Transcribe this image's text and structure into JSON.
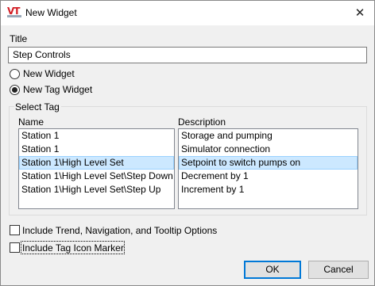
{
  "window": {
    "title": "New Widget",
    "close_glyph": "✕",
    "app_icon": "vtscada-logo-icon",
    "app_icon_text": "VT"
  },
  "title_field": {
    "label": "Title",
    "value": "Step Controls"
  },
  "widget_type": {
    "options": [
      {
        "label": "New Widget",
        "checked": false
      },
      {
        "label": "New Tag Widget",
        "checked": true
      }
    ]
  },
  "select_tag": {
    "group_label": "Select Tag",
    "name_header": "Name",
    "description_header": "Description",
    "names": [
      "Station 1",
      "Station 1",
      "Station 1\\High Level Set",
      "Station 1\\High Level Set\\Step Down",
      "Station 1\\High Level Set\\Step Up"
    ],
    "descriptions": [
      "Storage and pumping",
      "Simulator connection",
      "Setpoint to switch pumps on",
      "Decrement by 1",
      "Increment by 1"
    ],
    "selected_index": 2
  },
  "options": {
    "include_trend": {
      "label": "Include Trend, Navigation, and Tooltip Options",
      "checked": false
    },
    "include_icon": {
      "label": "Include Tag Icon Marker",
      "checked": false
    }
  },
  "buttons": {
    "ok": "OK",
    "cancel": "Cancel"
  },
  "colors": {
    "selection_bg": "#cce8ff",
    "selection_border": "#99d1ff",
    "brand_red": "#d21f26"
  }
}
